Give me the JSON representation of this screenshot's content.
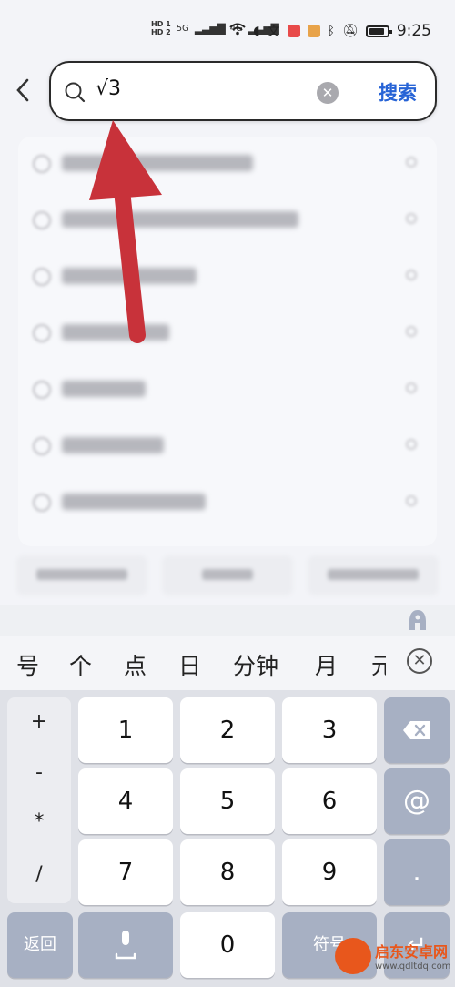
{
  "status_bar": {
    "hd1": "HD 1",
    "hd2": "HD 2",
    "net1": "5G",
    "net2": "4G",
    "time": "9:25"
  },
  "search": {
    "query": "√3",
    "search_label": "搜索"
  },
  "candidates": [
    "号",
    "个",
    "点",
    "日",
    "分钟",
    "月",
    "元"
  ],
  "keyboard": {
    "symbols": [
      "+",
      "-",
      "*",
      "/"
    ],
    "rows": [
      [
        "1",
        "2",
        "3"
      ],
      [
        "4",
        "5",
        "6"
      ],
      [
        "7",
        "8",
        "9"
      ]
    ],
    "at": "@",
    "dot": ".",
    "back_label": "返回",
    "zero": "0",
    "symbol_label": "符号"
  },
  "watermark": {
    "name": "启东安卓网",
    "url": "www.qdltdq.com"
  },
  "colors": {
    "accent": "#2663d6",
    "arrow": "#c8323a",
    "keyboard_dark": "#a7b0c3"
  }
}
